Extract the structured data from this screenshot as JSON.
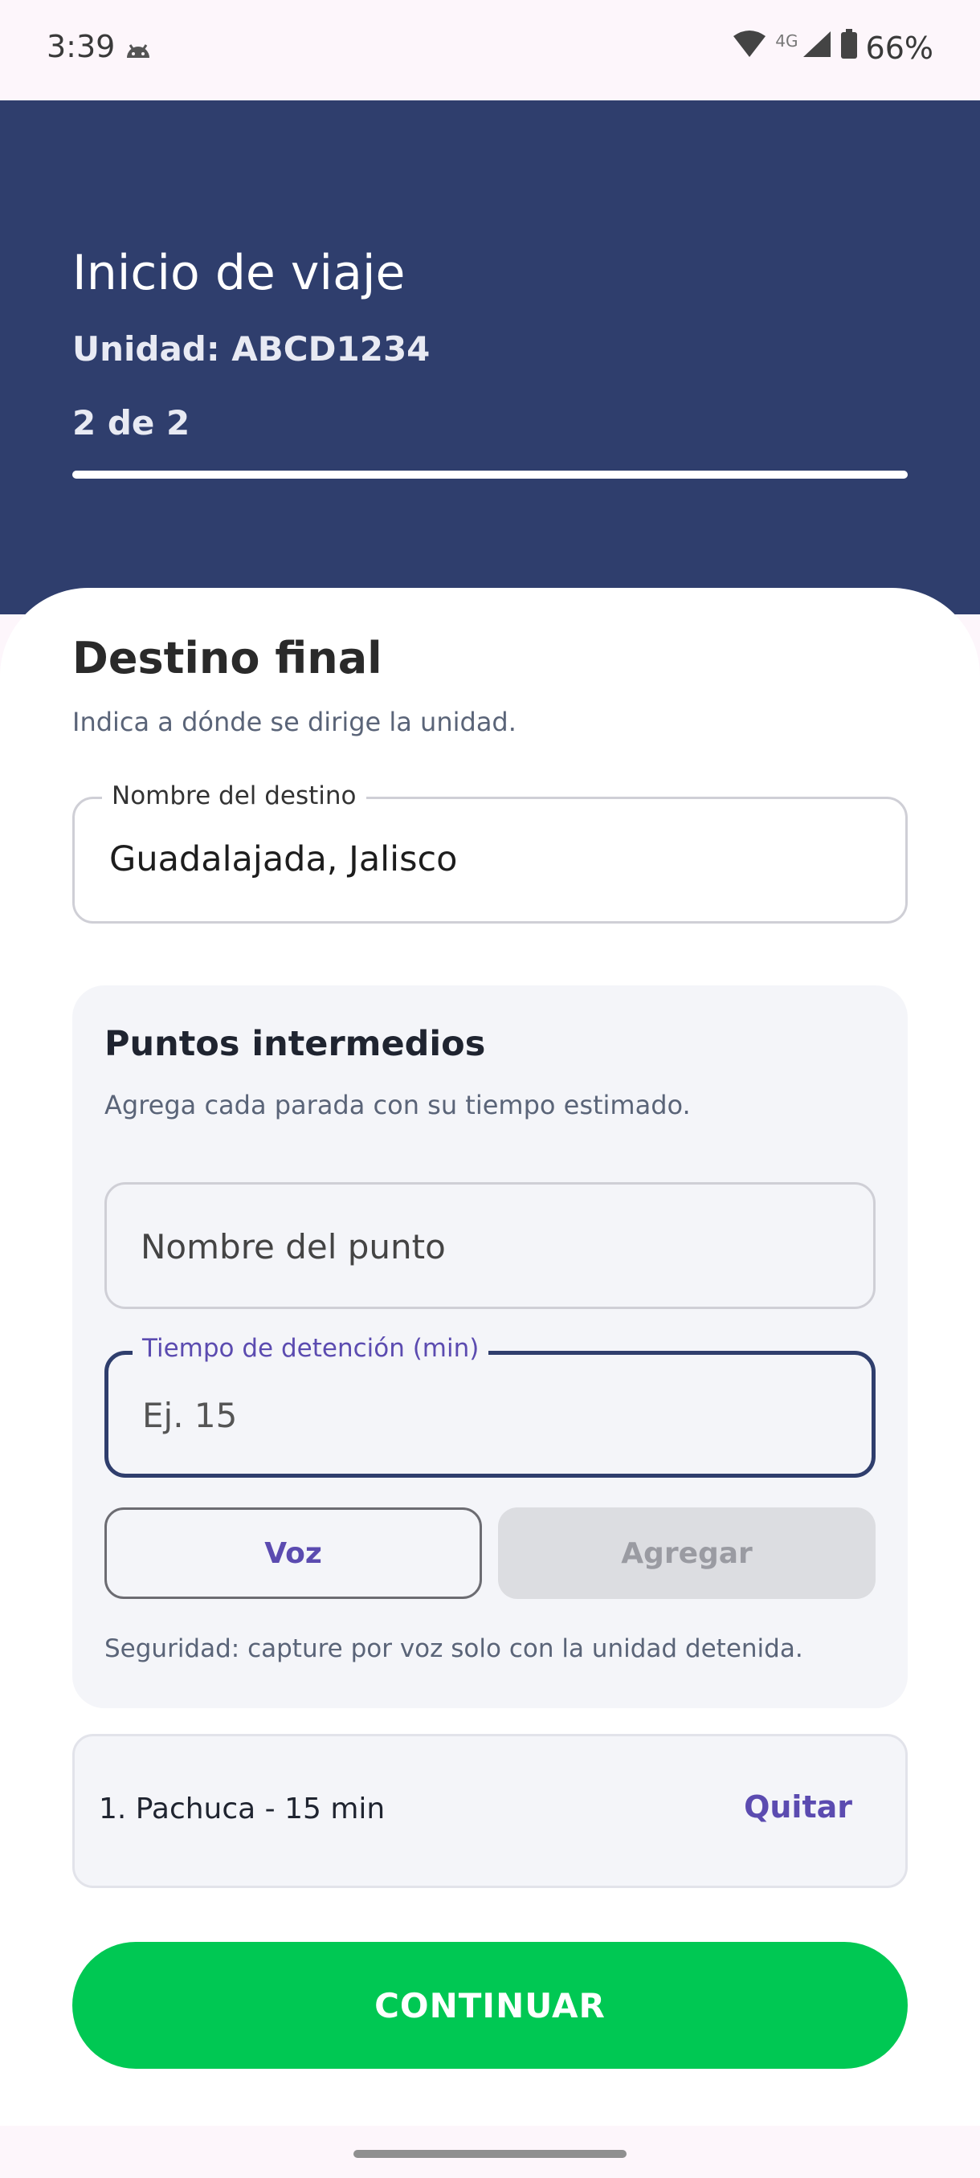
{
  "status_bar": {
    "time": "3:39",
    "network": "4G",
    "battery": "66%"
  },
  "header": {
    "title": "Inicio de viaje",
    "unit": "Unidad: ABCD1234",
    "step": "2 de 2",
    "progress": 1.0
  },
  "destination": {
    "title": "Destino final",
    "subtitle": "Indica a dónde se dirige la unidad.",
    "field_label": "Nombre del destino",
    "field_value": "Guadalajada, Jalisco"
  },
  "waypoints": {
    "title": "Puntos intermedios",
    "subtitle": "Agrega cada parada con su tiempo estimado.",
    "name_placeholder": "Nombre del punto",
    "time_label": "Tiempo de detención (min)",
    "time_placeholder": "Ej. 15",
    "voice_button": "Voz",
    "add_button": "Agregar",
    "safety_note": "Seguridad: capture por voz solo con la unidad detenida."
  },
  "stops": [
    {
      "text": "1. Pachuca - 15 min",
      "remove_label": "Quitar"
    }
  ],
  "continue_button": "CONTINUAR",
  "colors": {
    "header_bg": "#2f3e6d",
    "accent_purple": "#5b4bb0",
    "continue_green": "#00c853"
  }
}
